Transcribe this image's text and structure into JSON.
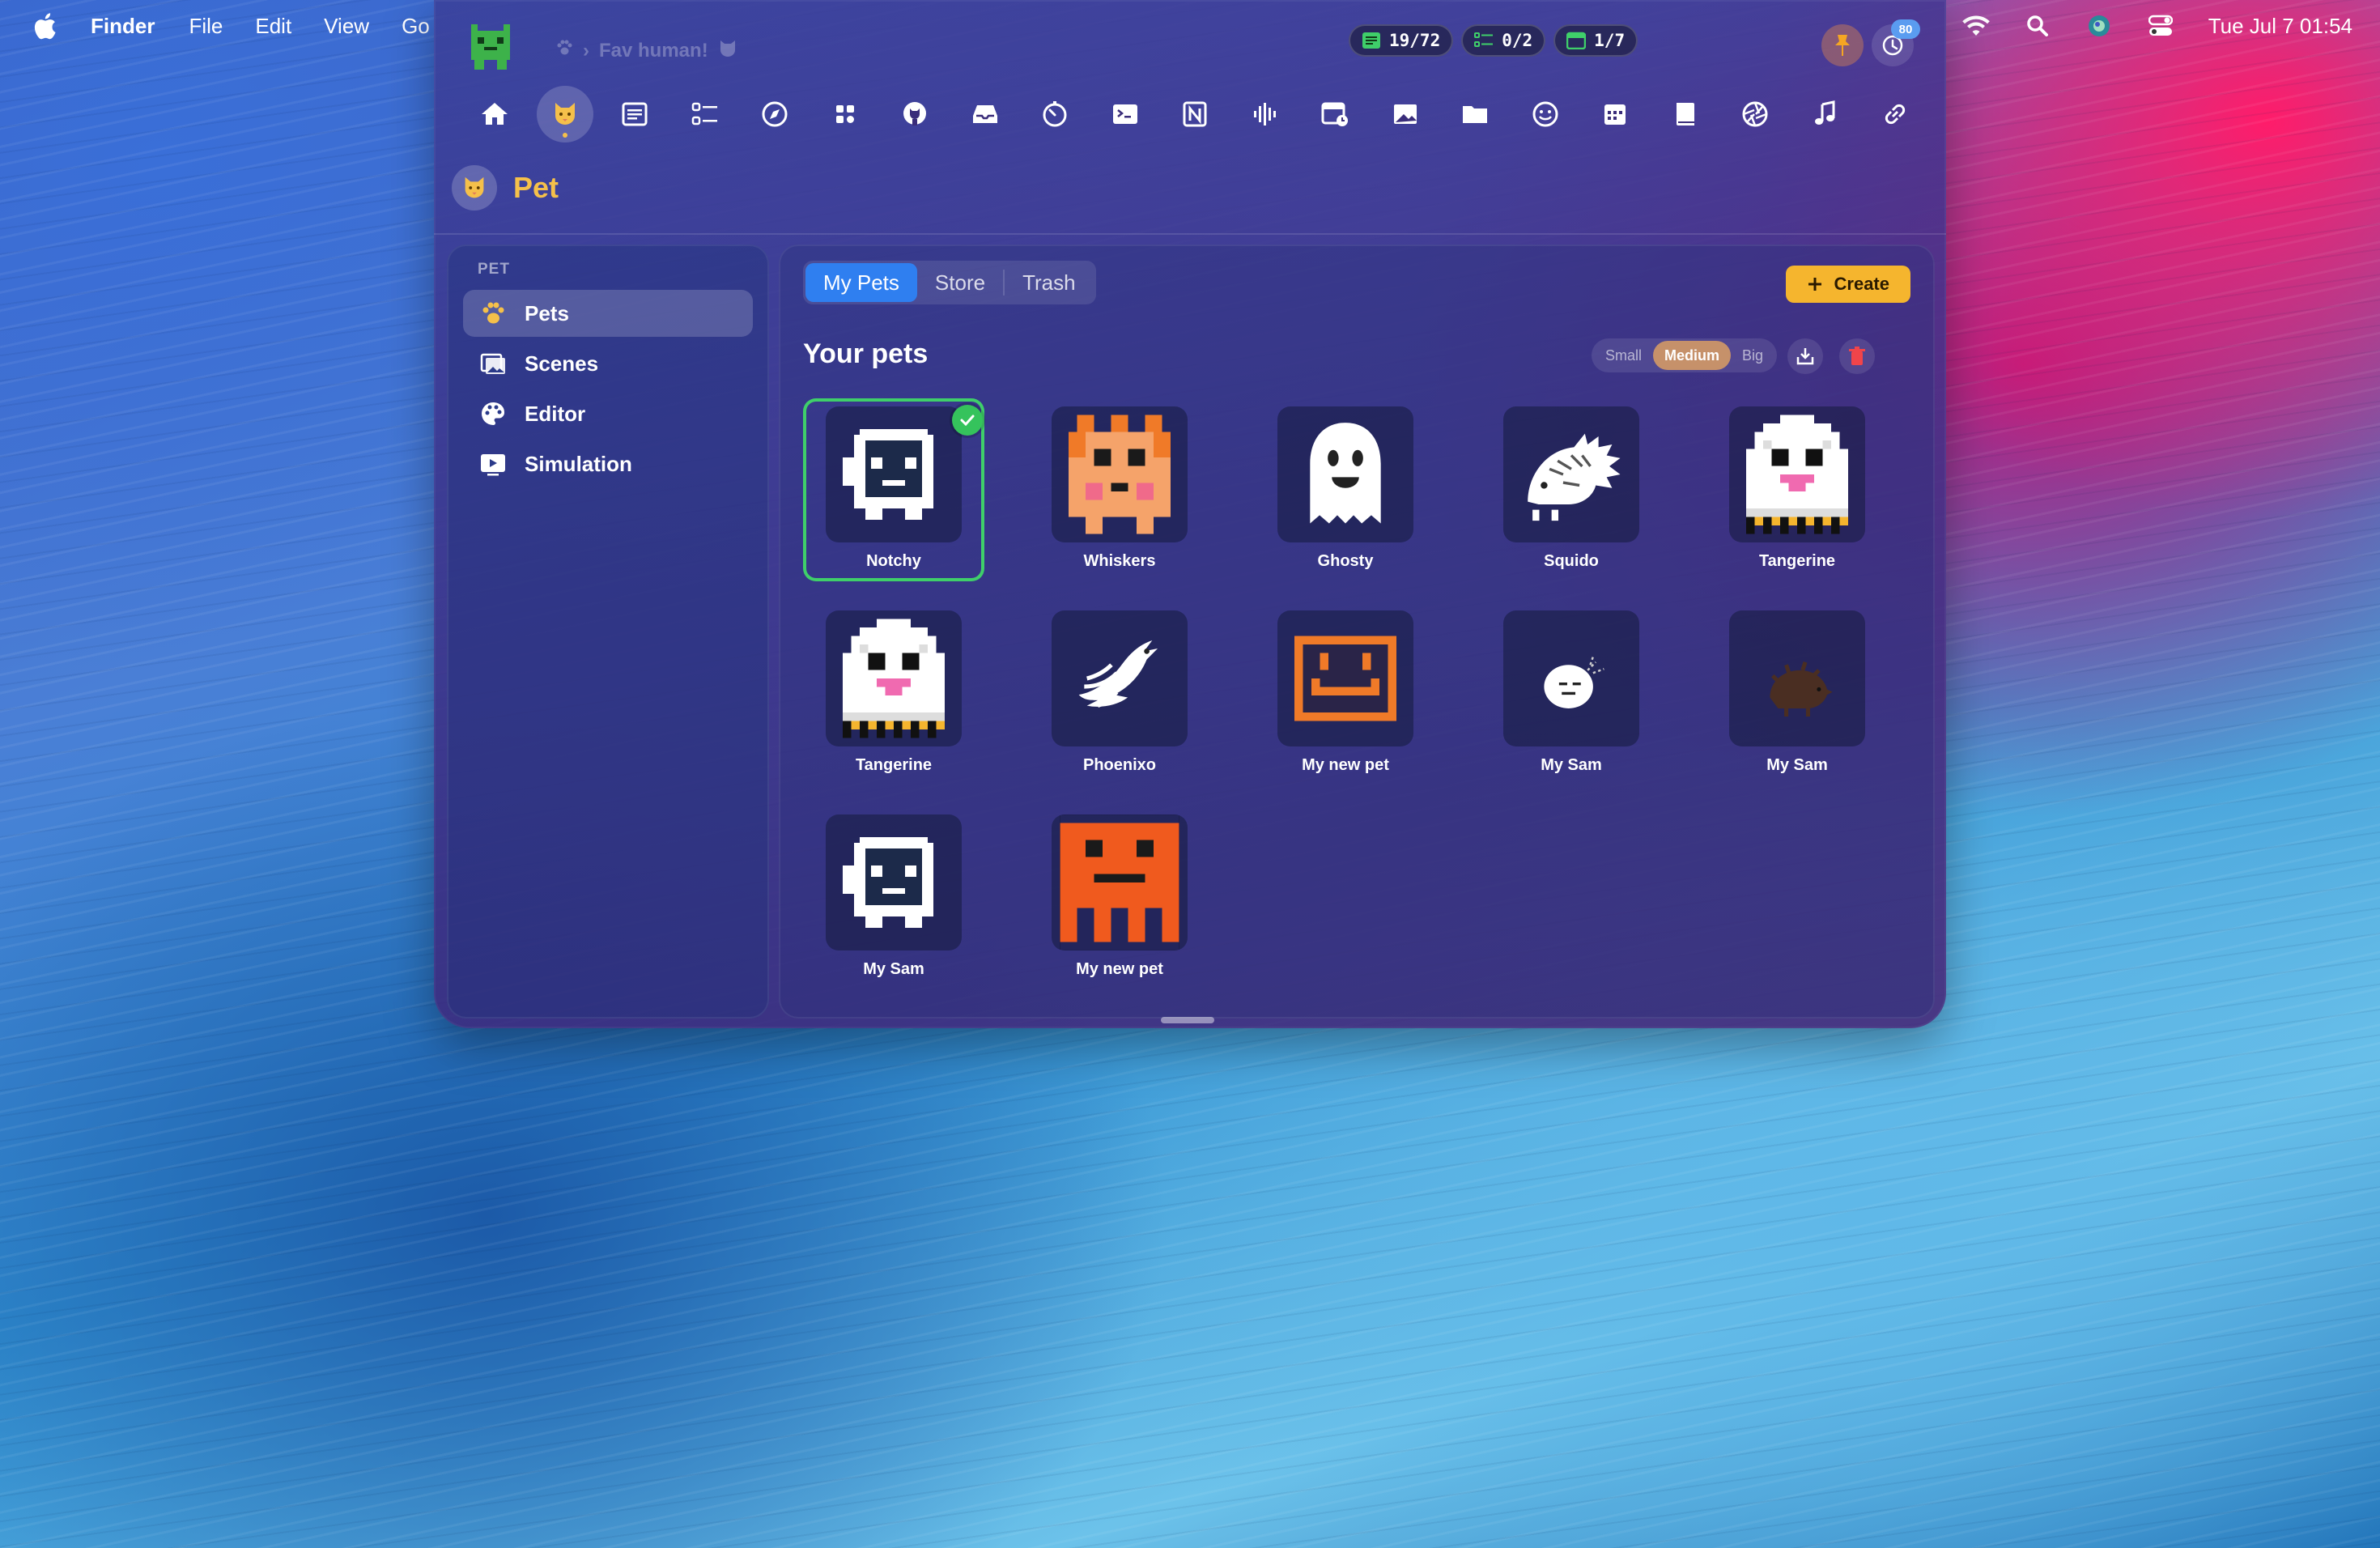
{
  "menubar": {
    "app_name": "Finder",
    "items": [
      "File",
      "Edit",
      "View",
      "Go"
    ],
    "clock": "Tue Jul 7  01:54",
    "icons": [
      "wifi-icon",
      "spotlight-icon",
      "siri-icon",
      "control-center-icon"
    ]
  },
  "window": {
    "breadcrumb": "Fav human!",
    "stats": [
      {
        "icon": "notes-icon",
        "value": "19/72"
      },
      {
        "icon": "checklist-icon",
        "value": "0/2"
      },
      {
        "icon": "calendar-icon",
        "value": "1/7"
      }
    ],
    "history_badge": "80",
    "toolbar_icons": [
      "home-icon",
      "pet-icon",
      "notes-icon",
      "checklist-icon",
      "compass-icon",
      "apps-icon",
      "github-icon",
      "inbox-icon",
      "timer-icon",
      "terminal-icon",
      "notion-icon",
      "audio-wave-icon",
      "calendar-clock-icon",
      "image-icon",
      "folder-icon",
      "emoji-icon",
      "calendar-icon",
      "book-icon",
      "aperture-icon",
      "music-icon",
      "link-icon"
    ],
    "page_title": "Pet"
  },
  "sidebar": {
    "header": "PET",
    "items": [
      {
        "label": "Pets",
        "icon": "paw-icon"
      },
      {
        "label": "Scenes",
        "icon": "scenes-icon"
      },
      {
        "label": "Editor",
        "icon": "palette-icon"
      },
      {
        "label": "Simulation",
        "icon": "play-icon"
      }
    ]
  },
  "main": {
    "tabs": [
      "My Pets",
      "Store",
      "Trash"
    ],
    "active_tab": "My Pets",
    "create_label": "Create",
    "section_title": "Your pets",
    "sizes": [
      "Small",
      "Medium",
      "Big"
    ],
    "active_size": "Medium",
    "pets": [
      {
        "name": "Notchy",
        "selected": true
      },
      {
        "name": "Whiskers"
      },
      {
        "name": "Ghosty"
      },
      {
        "name": "Squido"
      },
      {
        "name": "Tangerine"
      },
      {
        "name": "Tangerine"
      },
      {
        "name": "Phoenixo"
      },
      {
        "name": "My new pet"
      },
      {
        "name": "My Sam"
      },
      {
        "name": "My Sam"
      },
      {
        "name": "My Sam"
      },
      {
        "name": "My new pet"
      }
    ]
  },
  "colors": {
    "accent_blue": "#2f7ff0",
    "accent_yellow": "#f5b52e",
    "selection_green": "#3fcf6a",
    "title_yellow": "#f5c04a"
  }
}
